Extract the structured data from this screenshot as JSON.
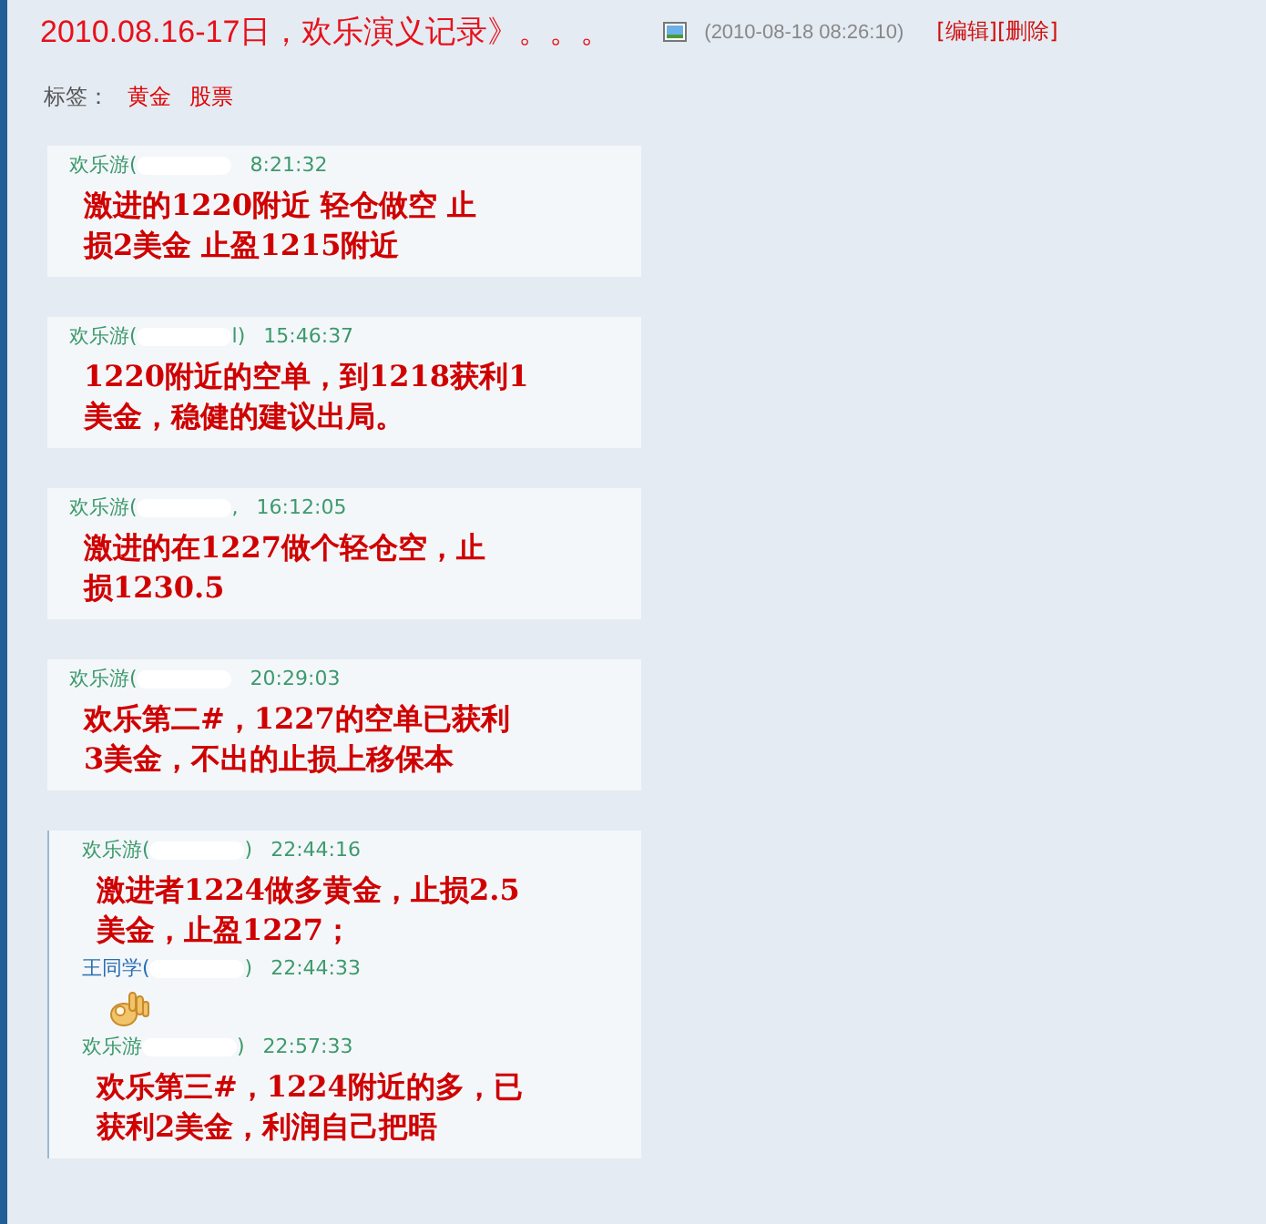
{
  "post": {
    "title": "2010.08.16-17日，欢乐演义记录》。。。",
    "date": "(2010-08-18 08:26:10)",
    "actions": [
      "[编辑]",
      "[删除]"
    ]
  },
  "tags": {
    "label": "标签：",
    "items": [
      "黄金",
      "股票"
    ]
  },
  "cards": [
    {
      "framed": false,
      "messages": [
        {
          "kind": "text",
          "sender": "欢乐游(",
          "time": "8:21:32",
          "lines": [
            "激进的1220附近 轻仓做空 止",
            "损2美金 止盈1215附近"
          ]
        }
      ]
    },
    {
      "framed": false,
      "messages": [
        {
          "kind": "text",
          "sender": "欢乐游(",
          "close": "l)",
          "time": "15:46:37",
          "lines": [
            "1220附近的空单，到1218获利1",
            "美金，稳健的建议出局。"
          ]
        }
      ]
    },
    {
      "framed": false,
      "messages": [
        {
          "kind": "text",
          "sender": "欢乐游(",
          "close": ",",
          "time": "16:12:05",
          "lines": [
            "激进的在1227做个轻仓空，止",
            "损1230.5"
          ]
        }
      ]
    },
    {
      "framed": false,
      "messages": [
        {
          "kind": "text",
          "sender": "欢乐游(",
          "time": "20:29:03",
          "lines": [
            "欢乐第二#，1227的空单已获利",
            "3美金，不出的止损上移保本"
          ]
        }
      ]
    },
    {
      "framed": true,
      "messages": [
        {
          "kind": "text",
          "sender": "欢乐游(",
          "close": ")",
          "time": "22:44:16",
          "lines": [
            "激进者1224做多黄金，止损2.5",
            "美金，止盈1227；"
          ]
        },
        {
          "kind": "emoji",
          "sender": "王同学(",
          "close": ")",
          "time": "22:44:33"
        },
        {
          "kind": "text",
          "sender": "欢乐游",
          "close": ")",
          "time": "22:57:33",
          "lines": [
            "欢乐第三#，1224附近的多，已",
            "获利2美金，利润自己把晤"
          ]
        }
      ]
    }
  ]
}
